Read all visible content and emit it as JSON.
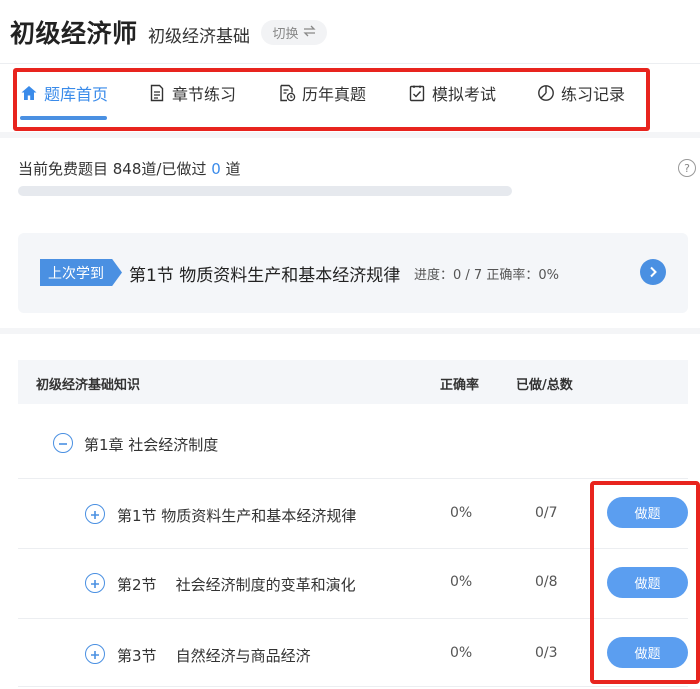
{
  "header": {
    "app_title": "初级经济师",
    "subject": "初级经济基础",
    "switch_label": "切换"
  },
  "nav": {
    "items": [
      {
        "label": "题库首页",
        "icon": "home-icon",
        "active": true
      },
      {
        "label": "章节练习",
        "icon": "document-icon",
        "active": false
      },
      {
        "label": "历年真题",
        "icon": "exam-history-icon",
        "active": false
      },
      {
        "label": "模拟考试",
        "icon": "checklist-icon",
        "active": false
      },
      {
        "label": "练习记录",
        "icon": "pie-chart-icon",
        "active": false
      }
    ]
  },
  "progress": {
    "prefix": "当前免费题目 848道/已做过 ",
    "done": "0",
    "suffix": " 道",
    "help_label": "?",
    "fraction": 0
  },
  "last_study": {
    "tag": "上次学到",
    "title": "第1节 物质资料生产和基本经济规律",
    "meta": "进度：0 / 7  正确率：0%"
  },
  "table": {
    "headers": {
      "name": "初级经济基础知识",
      "accuracy": "正确率",
      "done_total": "已做/总数"
    },
    "chapter": {
      "title": "第1章 社会经济制度",
      "toggle": "−"
    },
    "sections": [
      {
        "title": "第1节 物质资料生产和基本经济规律",
        "accuracy": "0%",
        "done_total": "0/7",
        "button": "做题",
        "toggle": "+"
      },
      {
        "title": "第2节    社会经济制度的变革和演化",
        "accuracy": "0%",
        "done_total": "0/8",
        "button": "做题",
        "toggle": "+"
      },
      {
        "title": "第3节    自然经济与商品经济",
        "accuracy": "0%",
        "done_total": "0/3",
        "button": "做题",
        "toggle": "+"
      }
    ]
  },
  "colors": {
    "accent": "#4a90e2",
    "highlight_box": "#e8241e"
  }
}
